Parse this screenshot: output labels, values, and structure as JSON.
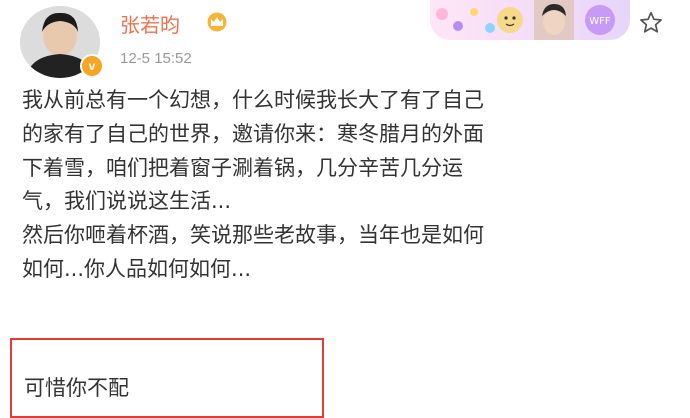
{
  "post": {
    "author_name": "张若昀",
    "timestamp": "12-5 15:52",
    "body_text": "我从前总有一个幻想，什么时候我长大了有了自己\n的家有了自己的世界，邀请你来：寒冬腊月的外面\n下着雪，咱们把着窗子涮着锅，几分辛苦几分运\n气，我们说说这生活...\n然后你咂着杯酒，笑说那些老故事，当年也是如何\n如何...你人品如何如何...",
    "highlighted_text": "可惜你不配",
    "verified_badge": "v"
  },
  "card_banner": {
    "badge_text": "WFF"
  },
  "icons": {
    "membership": "crown-icon",
    "follow": "star-icon"
  },
  "colors": {
    "username": "#eb7350",
    "timestamp": "#999999",
    "highlight_border": "#e33a3a",
    "verified": "#f6a623"
  }
}
